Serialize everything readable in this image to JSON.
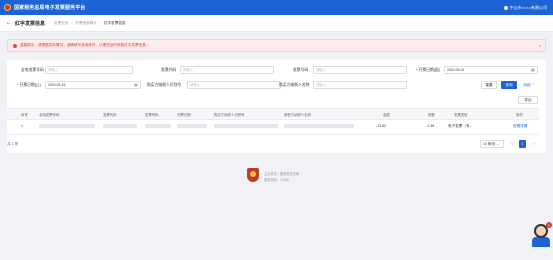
{
  "topbar": {
    "brand": "国家税务总局电子发票服务平台",
    "user": "中山市××××有限公司"
  },
  "header": {
    "back": "←",
    "title": "红字发票信息",
    "breadcrumbs": [
      "发票业务",
      "开票信息确认",
      "红字发票信息"
    ]
  },
  "alert": {
    "text": "温馨提示：请根据实际情况，准确填写查询条件，以便您及时获取红字发票信息。",
    "close": "×"
  },
  "filters": {
    "f1_label": "全电发票号码",
    "f1_ph": "请输入",
    "f2_label": "发票代码",
    "f2_ph": "请输入",
    "f3_label": "发票号码",
    "f3_ph": "请输入",
    "f4_label": "* 开票日期(起)",
    "f4_val": "2022-09-01",
    "f5_label": "* 开票日期(止)",
    "f5_val": "2022-09-15",
    "f6_label": "购买方纳税人识别号",
    "f6_ph": "请输入",
    "f7_label": "购买方纳税人名称",
    "f7_ph": "请输入",
    "reset": "重置",
    "search": "查询",
    "collapse": "收起 ⌃",
    "export": "导出"
  },
  "table": {
    "headers": [
      "序号",
      "全电发票号码",
      "发票代码",
      "发票号码",
      "开票日期",
      "购买方纳税人识别号",
      "销售方纳税人名称",
      "金额",
      "税额",
      "发票类型",
      "操作"
    ],
    "row": {
      "index": "1",
      "amount": "-13.62",
      "tax": "-1.38",
      "type": "电子发票（专...",
      "action": "查看详情"
    }
  },
  "pager": {
    "total": "共 1 条",
    "size": "10 条/页 ⌄",
    "prev": "<",
    "page": "1",
    "next": ">"
  },
  "footer": {
    "l1": "主办单位：国家税务总局",
    "l2": "服务热线：12366"
  },
  "assistant": {
    "badge": "1"
  },
  "colors": {
    "primary": "#1e63d6",
    "alert_bg": "#fdecec",
    "alert_text": "#d9363e"
  }
}
